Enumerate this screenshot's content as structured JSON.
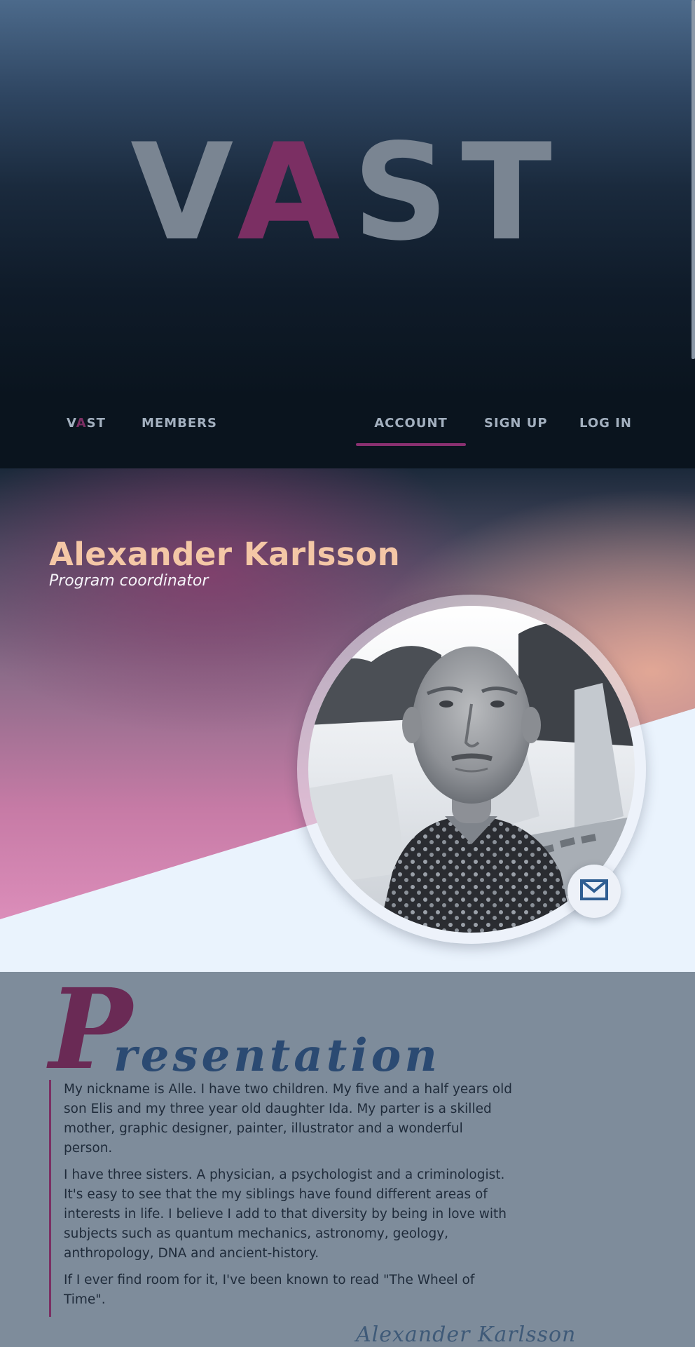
{
  "hero": {
    "logo_parts": [
      "V",
      "A",
      "ST"
    ]
  },
  "nav": {
    "brand_parts": [
      "V",
      "A",
      "ST"
    ],
    "members": "MEMBERS",
    "account": "ACCOUNT",
    "signup": "SIGN UP",
    "login": "LOG IN",
    "active": "ACCOUNT"
  },
  "profile": {
    "name": "Alexander Karlsson",
    "role": "Program coordinator",
    "mail_icon": "mail-icon"
  },
  "presentation": {
    "heading_initial": "P",
    "heading_rest": "resentation",
    "paragraphs": [
      "My nickname is Alle. I have two children. My five and a half years old son Elis and my three year old daughter Ida. My parter is a skilled mother, graphic designer, painter, illustrator and a wonderful person.",
      "I have three sisters. A physician, a psychologist and a criminologist. It's easy to see that the my siblings have found different areas of interests in life. I believe I add to that diversity by being in love with subjects such as quantum mechanics, astronomy, geology, anthropology, DNA and ancient-history.",
      "If I ever find room for it, I've been known to read \"The Wheel of Time\"."
    ],
    "signature": "Alexander Karlsson"
  },
  "colors": {
    "accent": "#7b2f63",
    "name": "#f4c7a6",
    "heading": "#2b4a72",
    "section_bg": "#7e8c9b"
  }
}
